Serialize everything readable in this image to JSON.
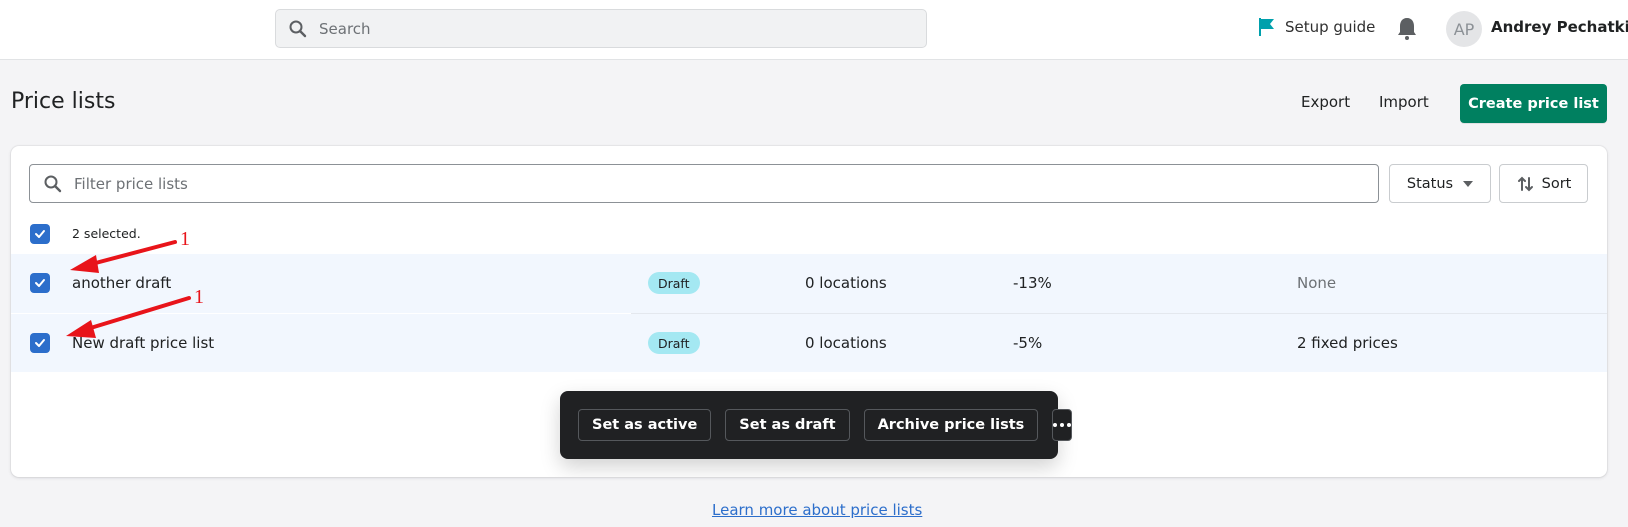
{
  "topbar": {
    "search_placeholder": "Search",
    "setup_guide_label": "Setup guide",
    "user_initials": "AP",
    "user_name": "Andrey Pechatkin",
    "icons": {
      "search": "search-icon",
      "flag": "flag-icon",
      "bell": "bell-icon"
    }
  },
  "page": {
    "title": "Price lists",
    "export_label": "Export",
    "import_label": "Import",
    "create_label": "Create price list"
  },
  "filters": {
    "filter_placeholder": "Filter price lists",
    "status_label": "Status",
    "sort_label": "Sort"
  },
  "selection": {
    "label": "2 selected."
  },
  "rows": [
    {
      "name": "another draft",
      "status": "Draft",
      "locations": "0 locations",
      "adjustment": "-13%",
      "fixed_prices": "None",
      "selected": true
    },
    {
      "name": "New draft price list",
      "status": "Draft",
      "locations": "0 locations",
      "adjustment": "-5%",
      "fixed_prices": "2 fixed prices",
      "selected": true
    }
  ],
  "bulk_actions": {
    "set_active": "Set as active",
    "set_draft": "Set as draft",
    "archive": "Archive price lists",
    "more_icon": "ellipsis-icon"
  },
  "annotations": [
    "1",
    "1"
  ],
  "footer": {
    "learn_more": "Learn more about price lists"
  },
  "colors": {
    "primary_green": "#008060",
    "checkbox_blue": "#2c6ecb",
    "draft_badge": "#a4e8f2",
    "annotation_red": "#e8141a",
    "link_blue": "#2c6ecb",
    "flag_teal": "#00a0ac"
  }
}
